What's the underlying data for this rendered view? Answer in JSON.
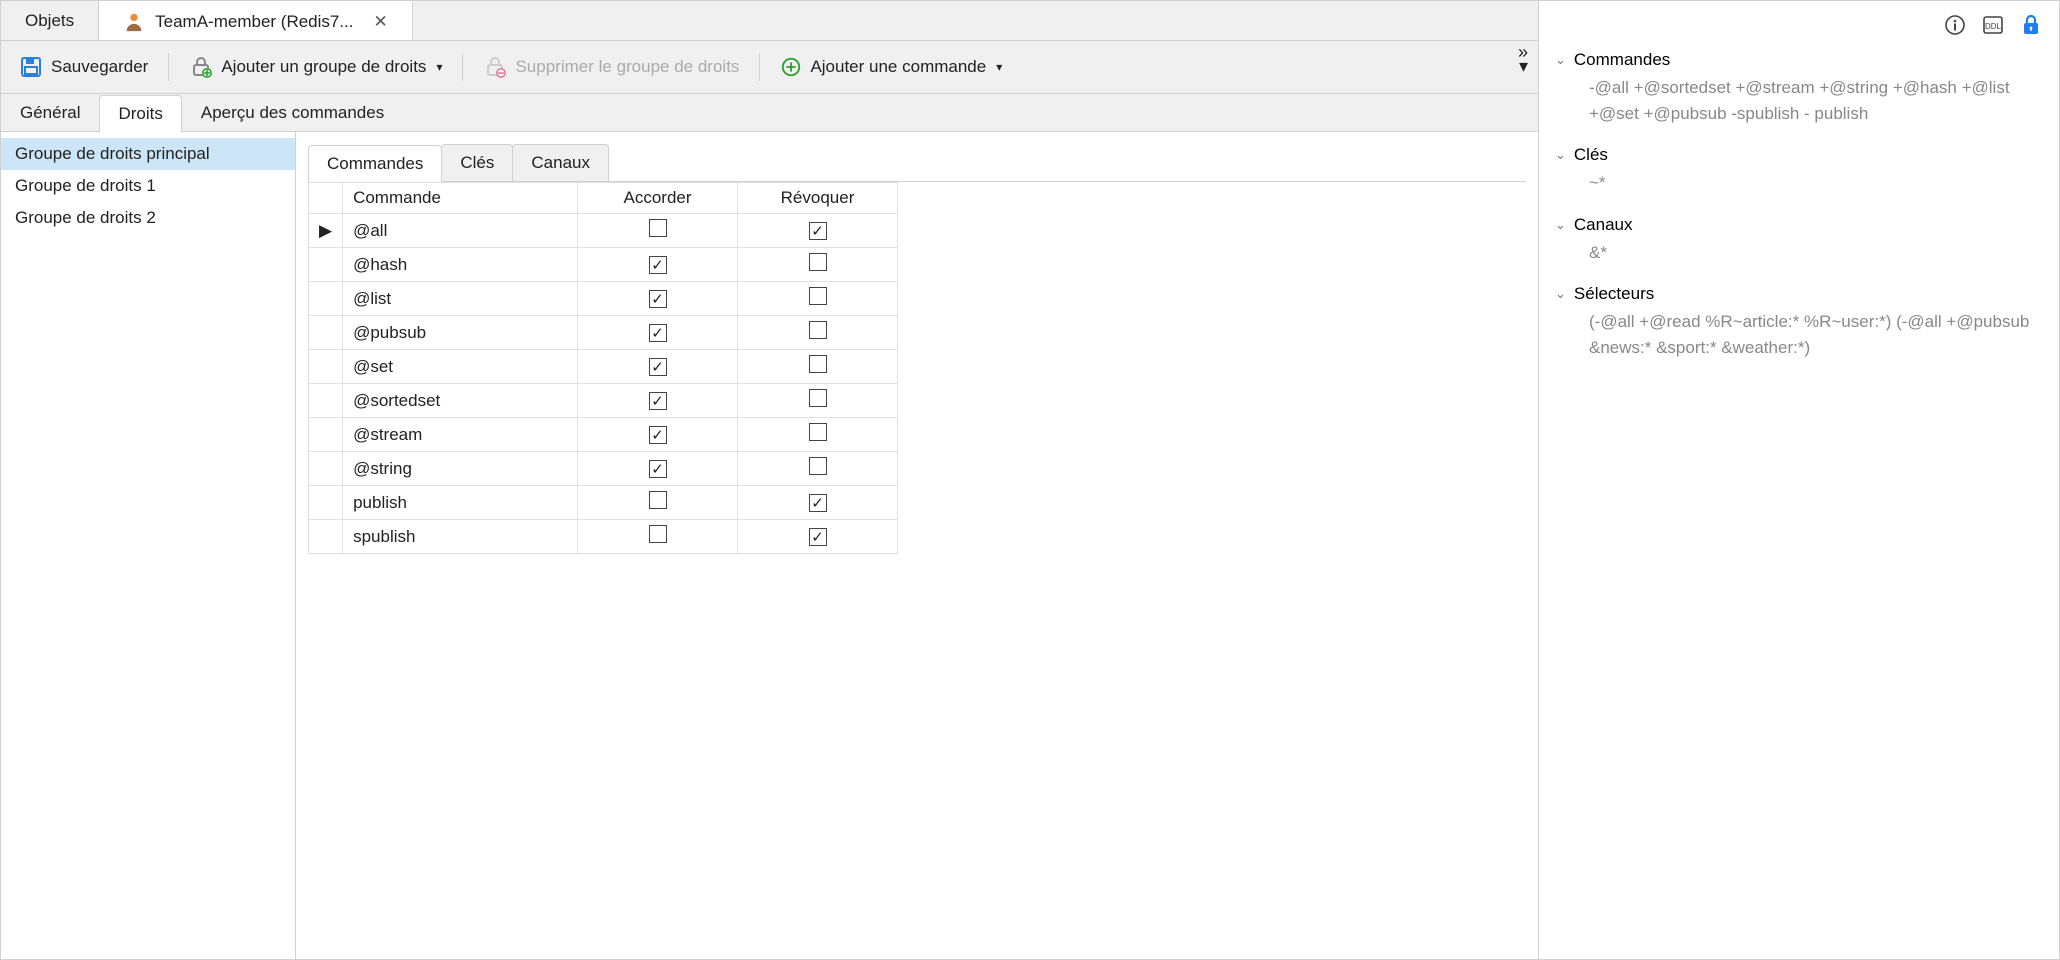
{
  "file_tabs": {
    "objects": "Objets",
    "active": "TeamA-member (Redis7..."
  },
  "toolbar": {
    "save": "Sauvegarder",
    "add_group": "Ajouter un groupe de droits",
    "remove_group": "Supprimer le groupe de droits",
    "add_cmd": "Ajouter une commande"
  },
  "subtabs": {
    "general": "Général",
    "rights": "Droits",
    "cmd_preview": "Aperçu des commandes"
  },
  "groups": {
    "items": [
      {
        "label": "Groupe de droits principal",
        "selected": true
      },
      {
        "label": "Groupe de droits 1",
        "selected": false
      },
      {
        "label": "Groupe de droits 2",
        "selected": false
      }
    ]
  },
  "inner_tabs": {
    "commands": "Commandes",
    "keys": "Clés",
    "channels": "Canaux"
  },
  "grid": {
    "cols": {
      "cmd": "Commande",
      "grant": "Accorder",
      "revoke": "Révoquer"
    },
    "rows": [
      {
        "cmd": "@all",
        "grant": false,
        "revoke": true,
        "current": true
      },
      {
        "cmd": "@hash",
        "grant": true,
        "revoke": false,
        "current": false
      },
      {
        "cmd": "@list",
        "grant": true,
        "revoke": false,
        "current": false
      },
      {
        "cmd": "@pubsub",
        "grant": true,
        "revoke": false,
        "current": false
      },
      {
        "cmd": "@set",
        "grant": true,
        "revoke": false,
        "current": false
      },
      {
        "cmd": "@sortedset",
        "grant": true,
        "revoke": false,
        "current": false
      },
      {
        "cmd": "@stream",
        "grant": true,
        "revoke": false,
        "current": false
      },
      {
        "cmd": "@string",
        "grant": true,
        "revoke": false,
        "current": false
      },
      {
        "cmd": "publish",
        "grant": false,
        "revoke": true,
        "current": false
      },
      {
        "cmd": "spublish",
        "grant": false,
        "revoke": true,
        "current": false
      }
    ]
  },
  "right_panel": {
    "commands": {
      "title": "Commandes",
      "body": "-@all +@sortedset +@stream +@string +@hash +@list +@set +@pubsub -spublish - publish"
    },
    "keys": {
      "title": "Clés",
      "body": "~*"
    },
    "channels": {
      "title": "Canaux",
      "body": "&*"
    },
    "selectors": {
      "title": "Sélecteurs",
      "body": "(-@all +@read %R~article:* %R~user:*) (-@all +@pubsub &news:* &sport:* &weather:*)"
    }
  }
}
